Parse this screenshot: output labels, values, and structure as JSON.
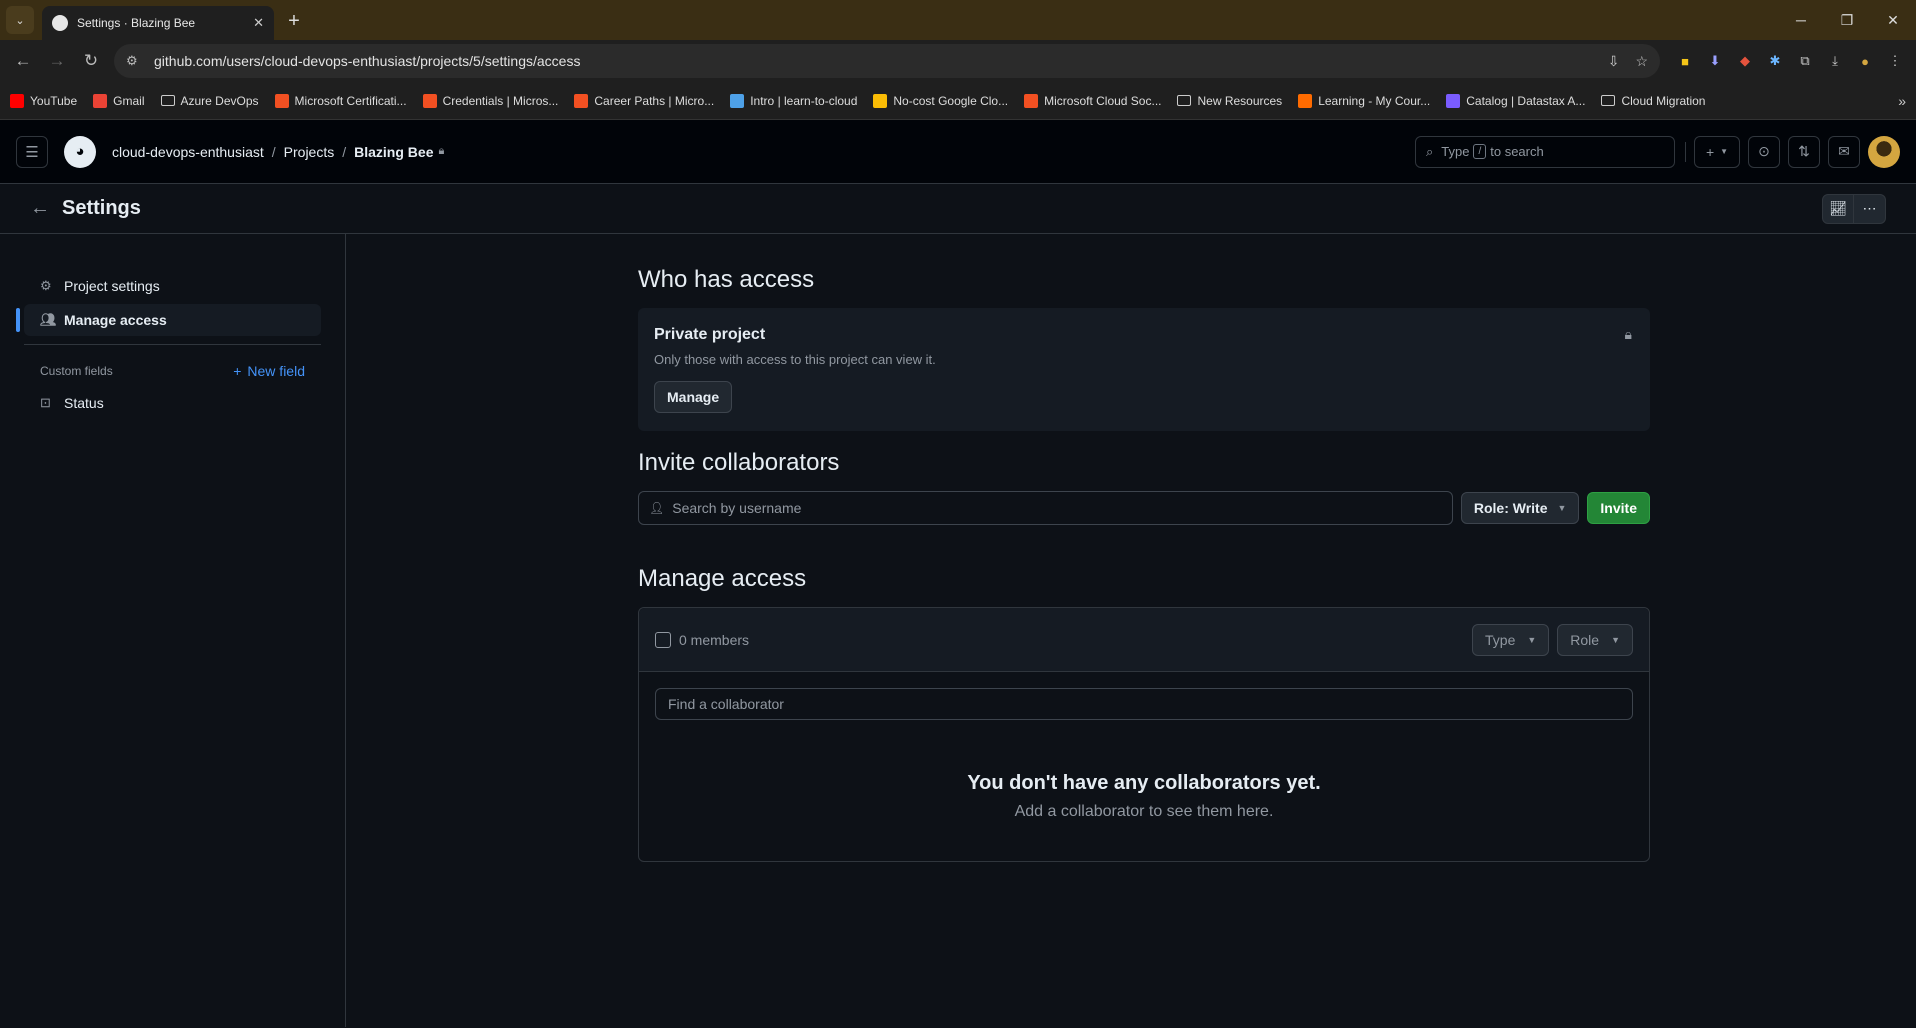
{
  "browser": {
    "tab_title": "Settings · Blazing Bee",
    "url": "github.com/users/cloud-devops-enthusiast/projects/5/settings/access",
    "bookmarks": [
      {
        "label": "YouTube",
        "color": "#ff0000"
      },
      {
        "label": "Gmail",
        "color": "#ea4335"
      },
      {
        "label": "Azure DevOps",
        "color": "folder"
      },
      {
        "label": "Microsoft Certificati...",
        "color": "#f25022"
      },
      {
        "label": "Credentials | Micros...",
        "color": "#f25022"
      },
      {
        "label": "Career Paths | Micro...",
        "color": "#f25022"
      },
      {
        "label": "Intro | learn-to-cloud",
        "color": "#4ea1e8"
      },
      {
        "label": "No-cost Google Clo...",
        "color": "#fbbc05"
      },
      {
        "label": "Microsoft Cloud Soc...",
        "color": "#f25022"
      },
      {
        "label": "New Resources",
        "color": "folder"
      },
      {
        "label": "Learning - My Cour...",
        "color": "#ff6b00"
      },
      {
        "label": "Catalog | Datastax A...",
        "color": "#7a5cff"
      },
      {
        "label": "Cloud Migration",
        "color": "folder"
      }
    ]
  },
  "header": {
    "owner": "cloud-devops-enthusiast",
    "projects": "Projects",
    "project": "Blazing Bee",
    "search_type": "Type",
    "search_key": "/",
    "search_rest": "to search"
  },
  "settings_bar": {
    "title": "Settings"
  },
  "sidebar": {
    "items": [
      {
        "label": "Project settings"
      },
      {
        "label": "Manage access"
      }
    ],
    "custom_fields_label": "Custom fields",
    "new_field": "New field",
    "fields": [
      {
        "label": "Status"
      }
    ]
  },
  "main": {
    "who_title": "Who has access",
    "private_title": "Private project",
    "private_desc": "Only those with access to this project can view it.",
    "manage_btn": "Manage",
    "invite_title": "Invite collaborators",
    "search_placeholder": "Search by username",
    "role_btn": "Role: Write",
    "invite_btn": "Invite",
    "manage_title": "Manage access",
    "members_count": "0 members",
    "type_filter": "Type",
    "role_filter": "Role",
    "find_placeholder": "Find a collaborator",
    "empty_title": "You don't have any collaborators yet.",
    "empty_desc": "Add a collaborator to see them here."
  },
  "colors": {
    "accent": "#4493f8",
    "invite_green": "#238636",
    "canvas": "#0d1117"
  }
}
